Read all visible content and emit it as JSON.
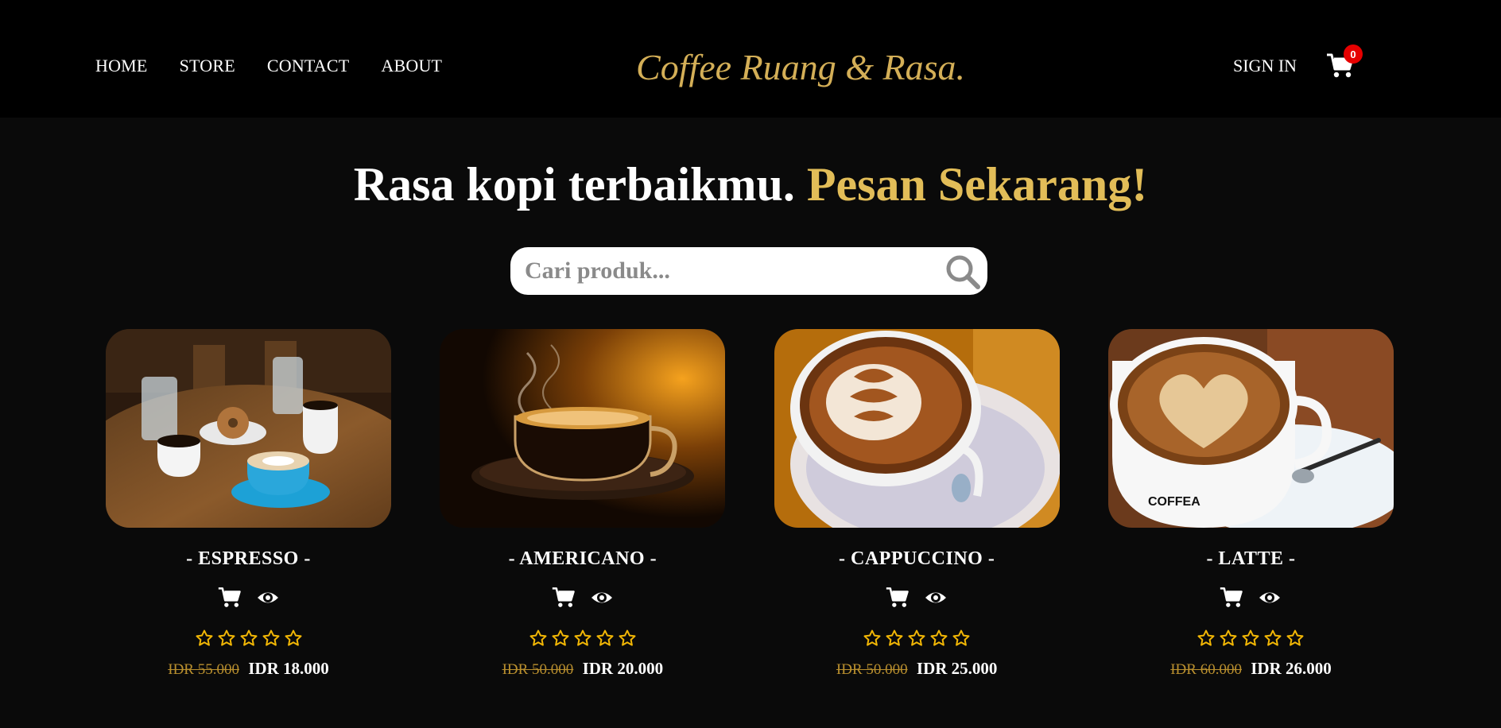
{
  "nav": {
    "items": [
      {
        "label": "HOME"
      },
      {
        "label": "STORE"
      },
      {
        "label": "CONTACT"
      },
      {
        "label": "ABOUT"
      }
    ],
    "brand": "Coffee Ruang & Rasa.",
    "signin": "SIGN IN",
    "cart_count": "0"
  },
  "hero": {
    "title": "Rasa kopi terbaikmu.",
    "accent": "Pesan Sekarang!"
  },
  "search": {
    "placeholder": "Cari produk..."
  },
  "colors": {
    "accent": "#d4af57",
    "badge": "#e60000",
    "star": "#f2b705",
    "old_price": "#b98f2e"
  },
  "products": [
    {
      "name": "- ESPRESSO -",
      "old_price": "IDR 55.000",
      "price": "IDR 18.000",
      "rating": 0
    },
    {
      "name": "- AMERICANO -",
      "old_price": "IDR 50.000",
      "price": "IDR 20.000",
      "rating": 0
    },
    {
      "name": "- CAPPUCCINO -",
      "old_price": "IDR 50.000",
      "price": "IDR 25.000",
      "rating": 0
    },
    {
      "name": "- LATTE -",
      "old_price": "IDR 60.000",
      "price": "IDR 26.000",
      "rating": 0
    }
  ]
}
